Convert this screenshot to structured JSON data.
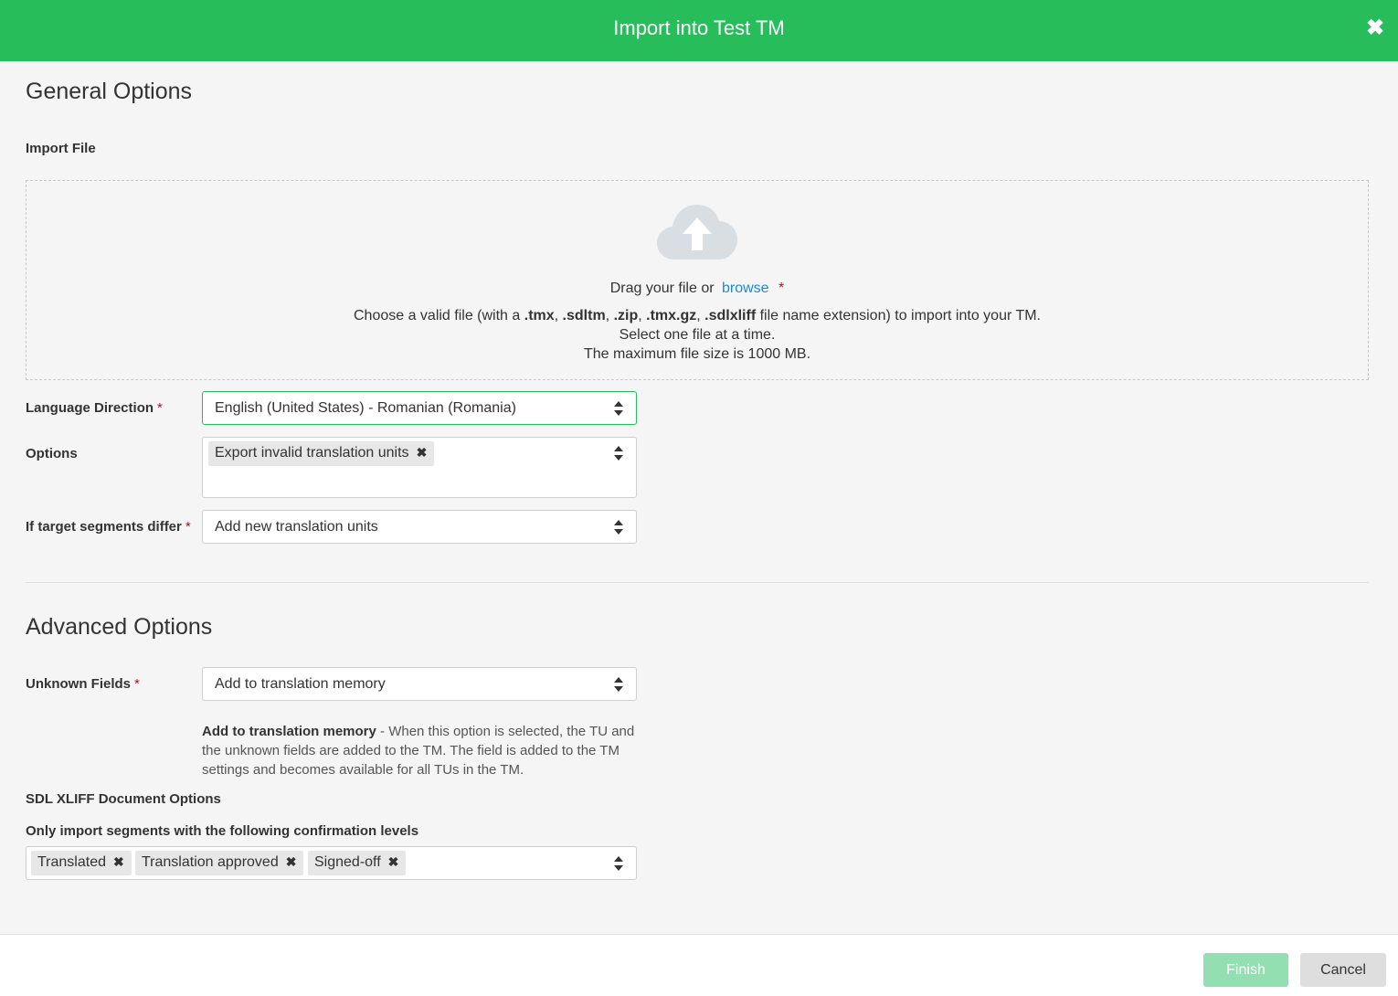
{
  "dialog": {
    "title": "Import into Test TM",
    "close_icon": "close-icon"
  },
  "general": {
    "title": "General Options",
    "import_file_label": "Import File",
    "dropzone": {
      "icon": "cloud-upload-icon",
      "drag_text": "Drag your file or",
      "browse_label": "browse",
      "required_mark": "*",
      "choose_prefix": "Choose a valid file (with a",
      "ext_tmx": ".tmx",
      "ext_sdltm": ".sdltm",
      "ext_zip": ".zip",
      "ext_tmxgz": ".tmx.gz",
      "ext_sdlxliff": ".sdlxliff",
      "choose_suffix": "file name extension) to import into your TM.",
      "one_file": "Select one file at a time.",
      "max_size": "The maximum file size is 1000 MB."
    },
    "language_direction": {
      "label": "Language Direction",
      "required_mark": "*",
      "value": "English (United States) - Romanian (Romania)"
    },
    "options": {
      "label": "Options",
      "tags": [
        "Export invalid translation units"
      ]
    },
    "target_differ": {
      "label": "If target segments differ",
      "required_mark": "*",
      "value": "Add new translation units"
    }
  },
  "advanced": {
    "title": "Advanced Options",
    "unknown_fields": {
      "label": "Unknown Fields",
      "required_mark": "*",
      "value": "Add to translation memory"
    },
    "help": {
      "bold": "Add to translation memory",
      "text": " - When this option is selected, the TU and the unknown fields are added to the TM. The field is added to the TM settings and becomes available for all TUs in the TM."
    },
    "sdlxliff_label": "SDL XLIFF Document Options",
    "confirmation_label": "Only import segments with the following confirmation levels",
    "confirmation_tags": [
      "Translated",
      "Translation approved",
      "Signed-off"
    ]
  },
  "footer": {
    "finish_label": "Finish",
    "cancel_label": "Cancel"
  },
  "colors": {
    "header": "#27bd5a",
    "link": "#1a8ad8",
    "required": "#d0021b",
    "finish_disabled": "#93dfb2"
  }
}
